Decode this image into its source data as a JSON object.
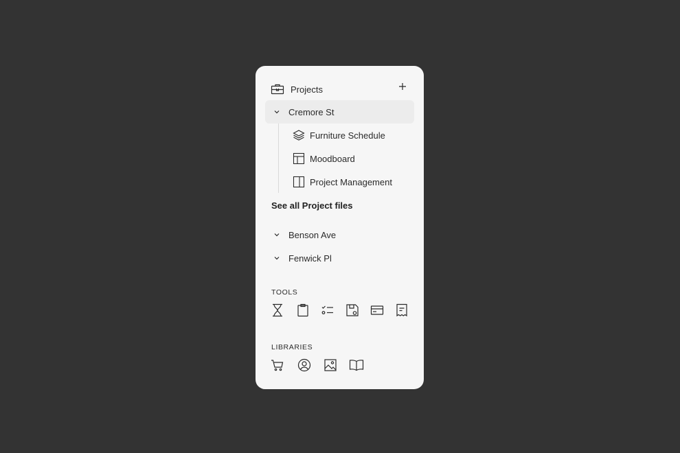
{
  "sidebar": {
    "projects_label": "Projects",
    "projects": [
      {
        "name": "Cremore St",
        "expanded": true,
        "selected": true,
        "items": [
          {
            "label": "Furniture Schedule",
            "icon": "layers-icon"
          },
          {
            "label": "Moodboard",
            "icon": "layout-icon"
          },
          {
            "label": "Project Management",
            "icon": "sidebar-panel-icon"
          }
        ]
      },
      {
        "name": "Benson Ave",
        "expanded": false
      },
      {
        "name": "Fenwick Pl",
        "expanded": false
      }
    ],
    "see_all_label": "See all Project files",
    "tools_label": "TOOLS",
    "tools": [
      "hourglass-icon",
      "clipboard-icon",
      "checklist-icon",
      "save-icon",
      "credit-card-icon",
      "receipt-icon"
    ],
    "libraries_label": "LIBRARIES",
    "libraries": [
      "cart-icon",
      "user-circle-icon",
      "image-icon",
      "book-icon"
    ]
  },
  "colors": {
    "background": "#333333",
    "panel": "#f6f6f6",
    "selected": "#ececec",
    "text": "#2a2a2a"
  }
}
